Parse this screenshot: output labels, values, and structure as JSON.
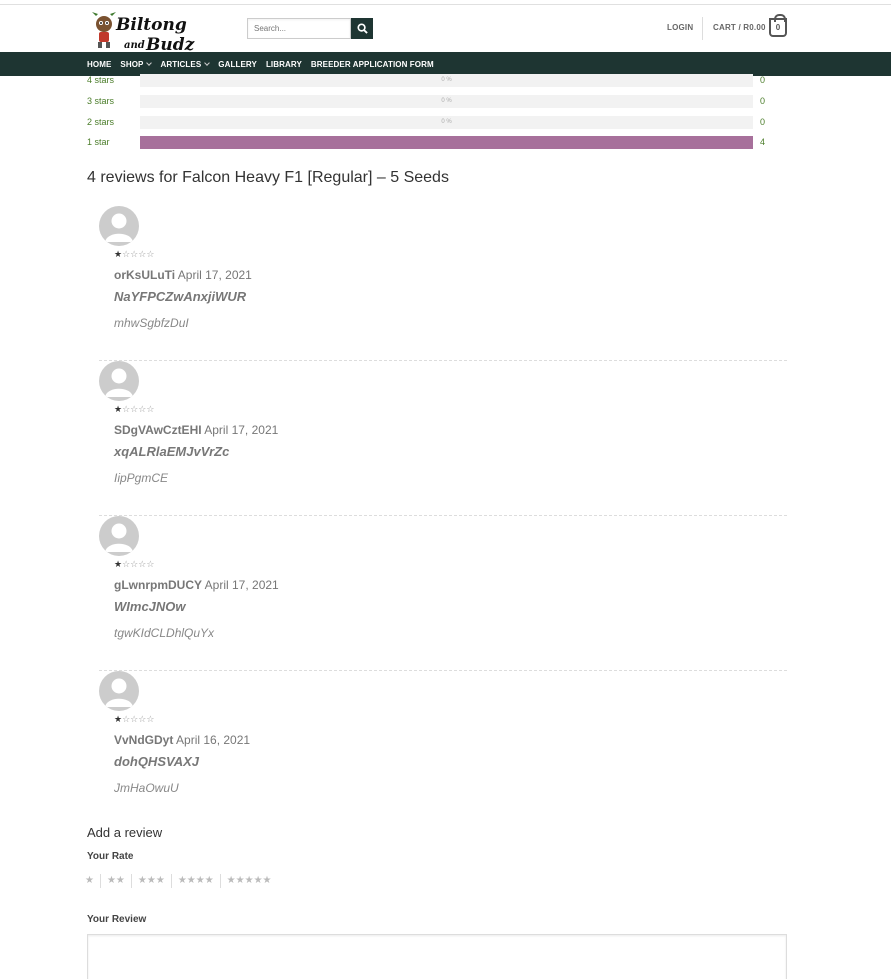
{
  "header": {
    "logo_text": "Biltong and Budz",
    "search_placeholder": "Search...",
    "login_label": "LOGIN",
    "cart_label": "CART / R0.00",
    "cart_count": "0"
  },
  "nav": {
    "items": [
      {
        "label": "HOME",
        "has_dropdown": false
      },
      {
        "label": "SHOP",
        "has_dropdown": true
      },
      {
        "label": "ARTICLES",
        "has_dropdown": true
      },
      {
        "label": "GALLERY",
        "has_dropdown": false
      },
      {
        "label": "LIBRARY",
        "has_dropdown": false
      },
      {
        "label": "BREEDER APPLICATION FORM",
        "has_dropdown": false
      }
    ]
  },
  "rating_breakdown": [
    {
      "label": "4 stars",
      "percent_text": "0 %",
      "fraction": 0,
      "count": "0"
    },
    {
      "label": "3 stars",
      "percent_text": "0 %",
      "fraction": 0,
      "count": "0"
    },
    {
      "label": "2 stars",
      "percent_text": "0 %",
      "fraction": 0,
      "count": "0"
    },
    {
      "label": "1 star",
      "percent_text": "",
      "fraction": 1,
      "count": "4"
    }
  ],
  "reviews_title": "4 reviews for Falcon Heavy F1 [Regular] – 5 Seeds",
  "reviews": [
    {
      "rating": 1,
      "author": "orKsULuTi",
      "date": "April 17, 2021",
      "title": "NaYFPCZwAnxjiWUR",
      "text": "mhwSgbfzDuI"
    },
    {
      "rating": 1,
      "author": "SDgVAwCztEHI",
      "date": "April 17, 2021",
      "title": "xqALRlaEMJvVrZc",
      "text": "IipPgmCE"
    },
    {
      "rating": 1,
      "author": "gLwnrpmDUCY",
      "date": "April 17, 2021",
      "title": "WImcJNOw",
      "text": "tgwKIdCLDhlQuYx"
    },
    {
      "rating": 1,
      "author": "VvNdGDyt",
      "date": "April 16, 2021",
      "title": "dohQHSVAXJ",
      "text": "JmHaOwuU"
    }
  ],
  "add_review": {
    "heading": "Add a review",
    "rate_label": "Your Rate",
    "rate_options": [
      "★",
      "★★",
      "★★★",
      "★★★★",
      "★★★★★"
    ],
    "review_label": "Your Review"
  },
  "colors": {
    "nav_bg": "#1e3532",
    "rating_fill": "#a7709b",
    "rating_label": "#4b7d2a"
  }
}
